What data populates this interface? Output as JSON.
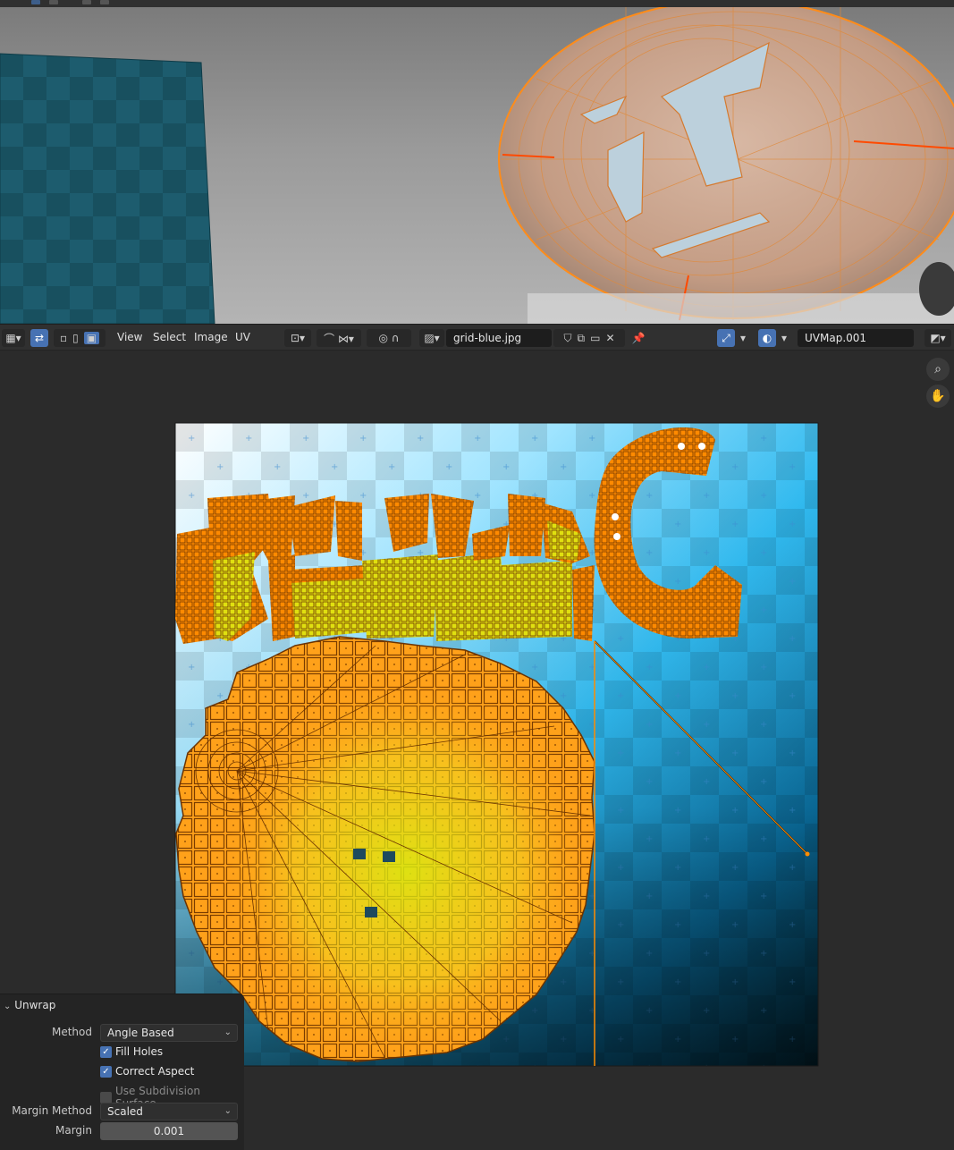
{
  "header": {
    "menus": [
      "View",
      "Select",
      "Image",
      "UV"
    ],
    "image_name": "grid-blue.jpg",
    "uv_map_name": "UVMap.001"
  },
  "operator_panel": {
    "title": "Unwrap",
    "method_label": "Method",
    "method_value": "Angle Based",
    "fill_holes_label": "Fill Holes",
    "fill_holes": true,
    "correct_aspect_label": "Correct Aspect",
    "correct_aspect": true,
    "use_subdivision_label": "Use Subdivision Surface",
    "use_subdivision": false,
    "margin_method_label": "Margin Method",
    "margin_method_value": "Scaled",
    "margin_label": "Margin",
    "margin_value": "0.001"
  },
  "colors": {
    "accent": "#4772b3",
    "uv_orange": "#ff8c00",
    "uv_yellow": "#e8e800"
  },
  "icons": [
    "zoom-icon",
    "hand-pan-icon",
    "pin-icon",
    "image-browse-icon",
    "uv-sync-icon"
  ]
}
